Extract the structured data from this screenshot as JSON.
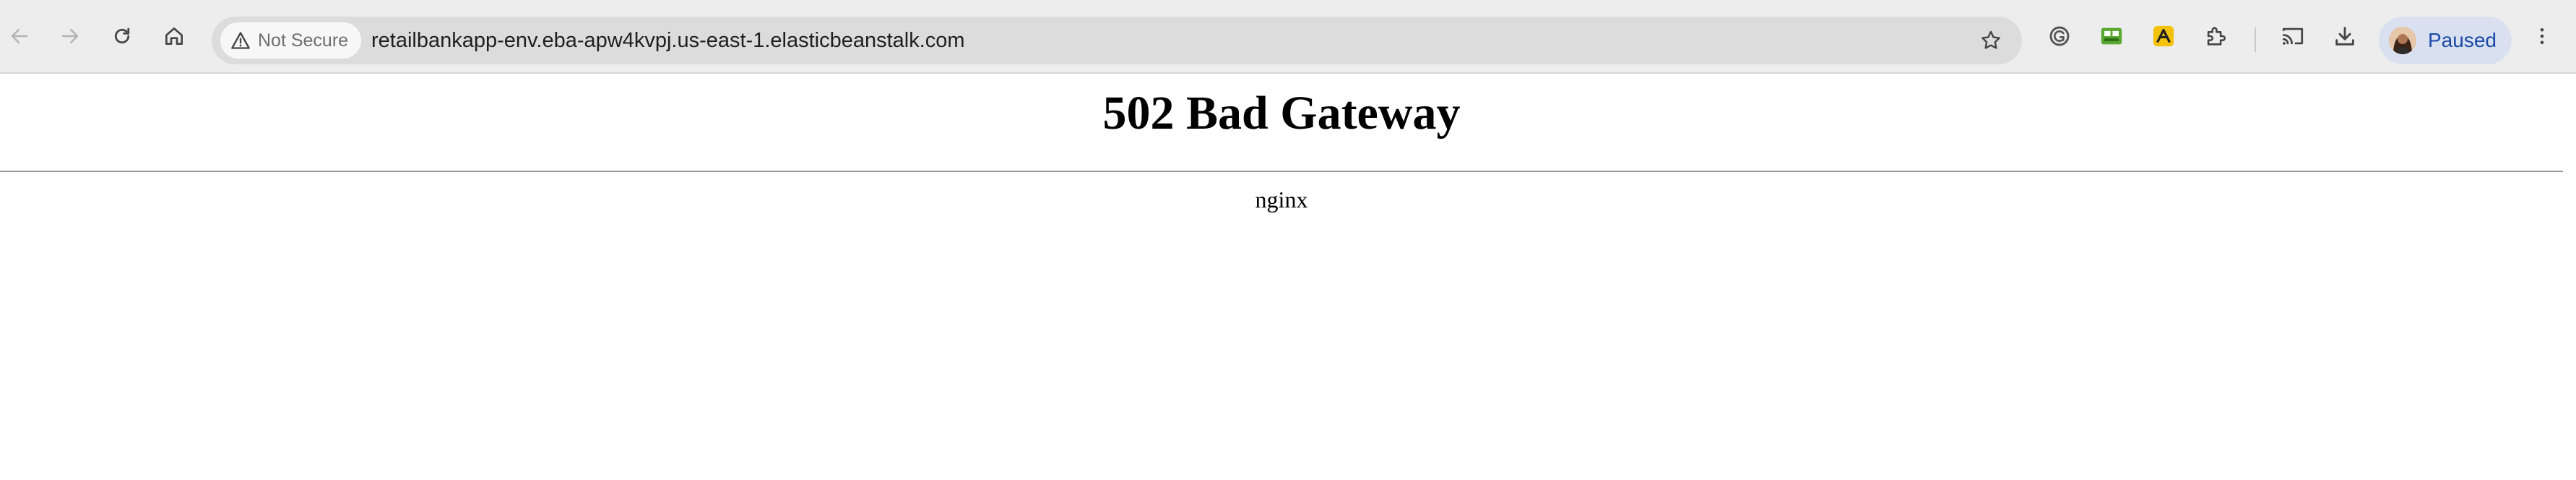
{
  "browser": {
    "security_chip": "Not Secure",
    "url": "retailbankapp-env.eba-apw4kvpj.us-east-1.elasticbeanstalk.com",
    "profile_status": "Paused",
    "toolbar_icons": [
      "back-icon",
      "forward-icon",
      "reload-icon",
      "home-icon",
      "star-icon",
      "grammarly-icon",
      "extension-green-icon",
      "extension-yellow-icon",
      "extensions-puzzle-icon",
      "cast-icon",
      "download-icon",
      "menu-icon"
    ],
    "colors": {
      "toolbar": "#ededed",
      "omnibox": "#dcdcdc",
      "profile_chip": "#d9e1f0",
      "profile_text": "#1a4aa6"
    }
  },
  "page": {
    "title": "502 Bad Gateway",
    "server": "nginx"
  }
}
